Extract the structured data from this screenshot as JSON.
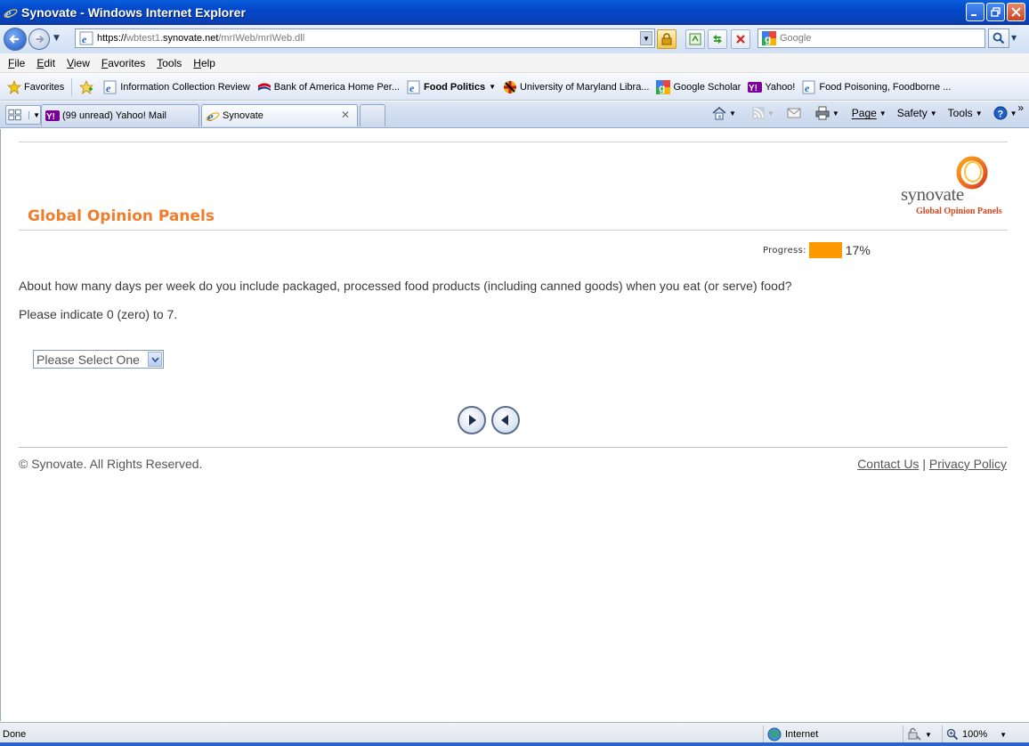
{
  "window": {
    "title": "Synovate - Windows Internet Explorer"
  },
  "address": {
    "url_prefix": "https://",
    "url_dim1": "wbtest1.",
    "url_host": "synovate.net",
    "url_path": "/mrIWeb/mrIWeb.dll",
    "search_placeholder": "Google"
  },
  "menu": {
    "items": [
      {
        "first": "F",
        "rest": "ile"
      },
      {
        "first": "E",
        "rest": "dit"
      },
      {
        "first": "V",
        "rest": "iew"
      },
      {
        "first": "F",
        "rest": "avorites"
      },
      {
        "first": "T",
        "rest": "ools"
      },
      {
        "first": "H",
        "rest": "elp"
      }
    ]
  },
  "favorites": {
    "label": "Favorites",
    "items": [
      "Information Collection Review",
      "Bank of America  Home  Per...",
      "Food Politics",
      "University of Maryland Libra...",
      "Google Scholar",
      "Yahoo!",
      "Food Poisoning, Foodborne ..."
    ]
  },
  "tabs": [
    {
      "label": "(99 unread) Yahoo! Mail"
    },
    {
      "label": "Synovate"
    }
  ],
  "command_bar": {
    "page": "Page",
    "safety": "Safety",
    "tools": "Tools"
  },
  "page": {
    "brand_title": "Global Opinion Panels",
    "logo_word": "synovate",
    "logo_sub": "Global Opinion Panels",
    "progress_label": "Progress:",
    "progress_value": 0.17,
    "progress_text": "17%",
    "question": "About how many days per week do you include packaged, processed food products (including canned goods) when you eat (or serve) food?",
    "instruction": "Please indicate 0 (zero) to 7.",
    "select_value": "Please Select One",
    "copyright": "© Synovate. All Rights Reserved.",
    "contact_link": "Contact Us",
    "separator": " | ",
    "privacy_link": "Privacy Policy",
    "colors": {
      "brand_orange": "#f07d2c",
      "progress_fill": "#ff9900"
    }
  },
  "status": {
    "text": "Done",
    "zone": "Internet",
    "zoom": "100%"
  }
}
